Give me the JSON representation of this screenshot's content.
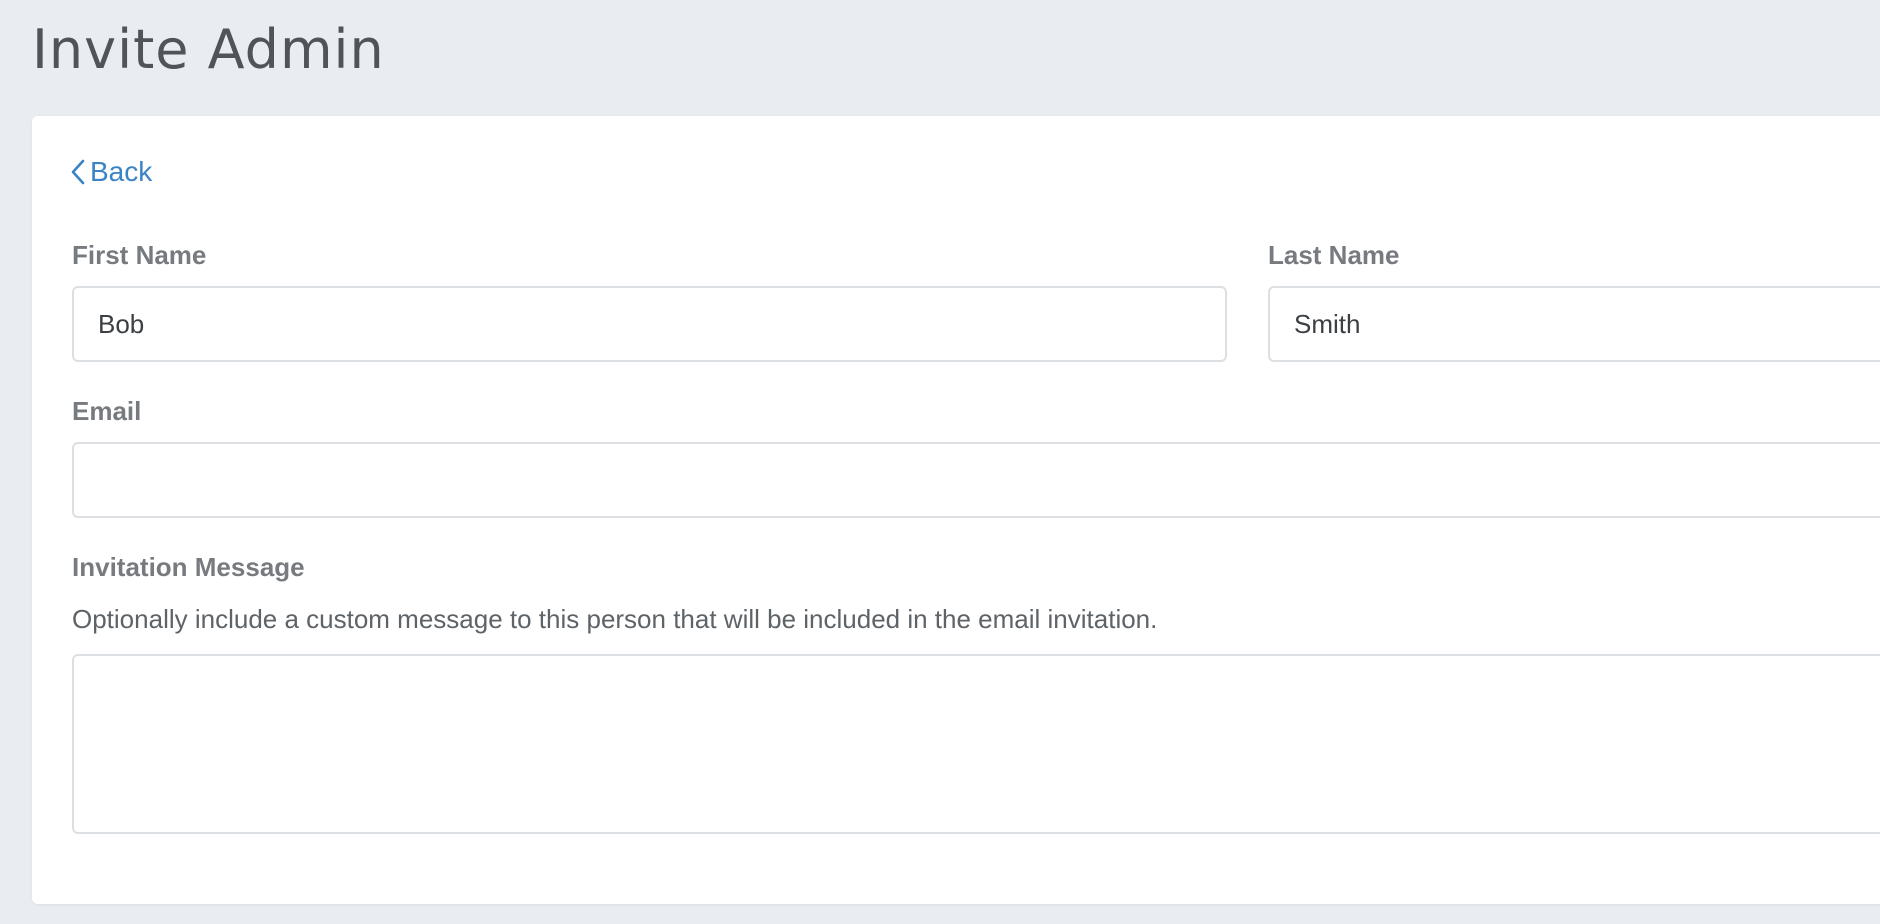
{
  "page": {
    "title": "Invite Admin"
  },
  "nav": {
    "back_label": "Back"
  },
  "form": {
    "first_name": {
      "label": "First Name",
      "value": "Bob"
    },
    "last_name": {
      "label": "Last Name",
      "value": "Smith"
    },
    "email": {
      "label": "Email",
      "value": ""
    },
    "invitation_message": {
      "label": "Invitation Message",
      "help": "Optionally include a custom message to this person that will be included in the email invitation.",
      "value": ""
    }
  },
  "colors": {
    "background": "#e9edf1",
    "link": "#3a83c4",
    "label": "#777b80",
    "border": "#dcdfe3"
  }
}
